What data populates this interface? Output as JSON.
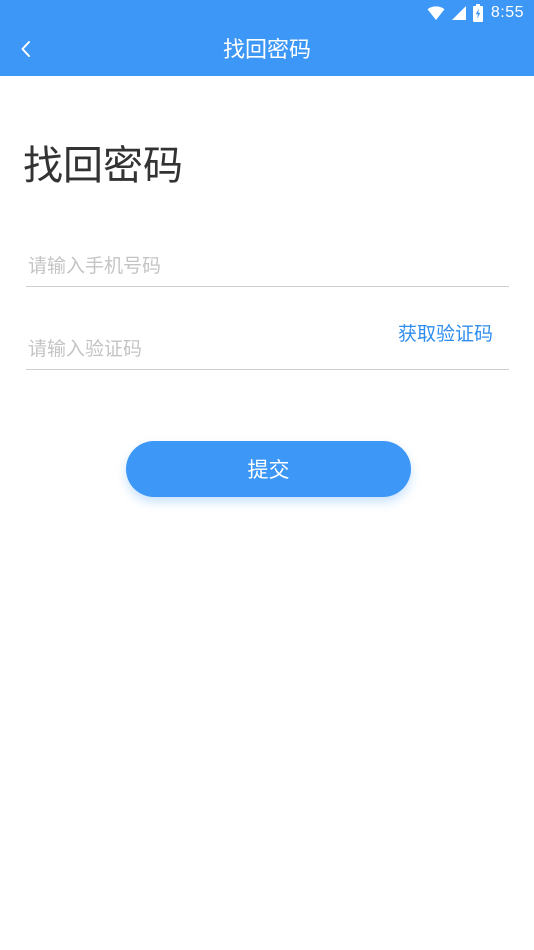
{
  "status_bar": {
    "time": "8:55",
    "icons": [
      "wifi-icon",
      "cell-signal-icon",
      "battery-charging-icon"
    ]
  },
  "app_bar": {
    "title": "找回密码",
    "back_icon": "chevron-left-icon"
  },
  "main": {
    "heading": "找回密码",
    "phone_input": {
      "placeholder": "请输入手机号码",
      "value": ""
    },
    "code_input": {
      "placeholder": "请输入验证码",
      "value": ""
    },
    "get_code_label": "获取验证码",
    "submit_label": "提交"
  },
  "colors": {
    "primary": "#3d97f7",
    "link": "#2f8ef0",
    "text": "#333333",
    "placeholder": "#c4c4c4",
    "divider": "#cfcfcf"
  }
}
